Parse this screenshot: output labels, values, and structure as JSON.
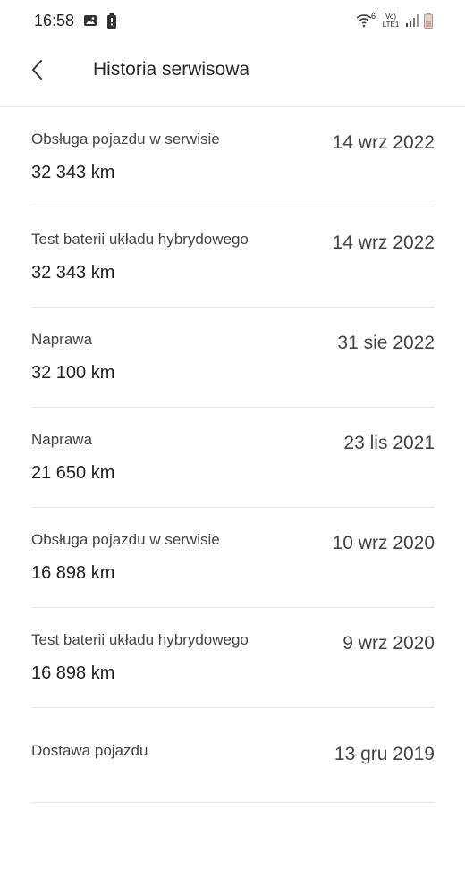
{
  "status_bar": {
    "time": "16:58",
    "network_label": "Vo) LTE1",
    "wifi_badge": "6"
  },
  "header": {
    "title": "Historia serwisowa",
    "back_icon": "chevron-left-icon"
  },
  "history": [
    {
      "type": "Obsługa pojazdu w serwisie",
      "mileage": "32 343 km",
      "date": "14 wrz 2022"
    },
    {
      "type": "Test baterii układu hybrydowego",
      "mileage": "32 343 km",
      "date": "14 wrz 2022"
    },
    {
      "type": "Naprawa",
      "mileage": "32 100 km",
      "date": "31 sie 2022"
    },
    {
      "type": "Naprawa",
      "mileage": "21 650 km",
      "date": "23 lis 2021"
    },
    {
      "type": "Obsługa pojazdu w serwisie",
      "mileage": "16 898 km",
      "date": "10 wrz 2020"
    },
    {
      "type": "Test baterii układu hybrydowego",
      "mileage": "16 898 km",
      "date": "9 wrz 2020"
    },
    {
      "type": "Dostawa pojazdu",
      "mileage": "",
      "date": "13 gru 2019"
    }
  ]
}
